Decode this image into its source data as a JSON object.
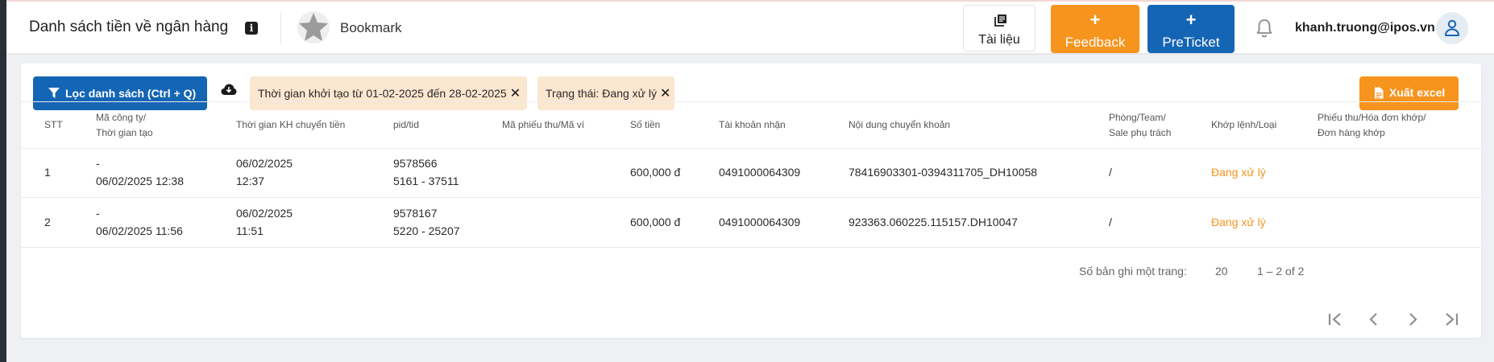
{
  "header": {
    "title": "Danh sách tiền về ngân hàng",
    "bookmark_label": "Bookmark",
    "docs_label": "Tài liệu",
    "feedback_label": "Feedback",
    "preticket_label": "PreTicket",
    "plus": "+",
    "user_email": "khanh.truong@ipos.vn"
  },
  "toolbar": {
    "filter_label": "Lọc danh sách (Ctrl + Q)",
    "chips": [
      {
        "text": "Thời gian khởi tạo từ 01-02-2025 đến 28-02-2025"
      },
      {
        "text": "Trạng thái: Đang xử lý"
      }
    ],
    "chip_remove": "✕",
    "export_label": "Xuất excel"
  },
  "table": {
    "columns": [
      {
        "line1": "STT",
        "line2": ""
      },
      {
        "line1": "Mã công ty/",
        "line2": "Thời gian tạo"
      },
      {
        "line1": "Thời gian KH chuyển tiền",
        "line2": ""
      },
      {
        "line1": "pid/tid",
        "line2": ""
      },
      {
        "line1": "Mã phiếu thu/Mã ví",
        "line2": ""
      },
      {
        "line1": "Số tiền",
        "line2": ""
      },
      {
        "line1": "Tài khoản nhận",
        "line2": ""
      },
      {
        "line1": "Nội dung chuyển khoản",
        "line2": ""
      },
      {
        "line1": "Phòng/Team/",
        "line2": "Sale phụ trách"
      },
      {
        "line1": "Khớp lệnh/Loại",
        "line2": ""
      },
      {
        "line1": "Phiếu thu/Hóa đơn khớp/",
        "line2": "Đơn hàng khớp"
      }
    ],
    "rows": [
      {
        "stt": "1",
        "company": "-",
        "created": "06/02/2025 12:38",
        "transfer_date": "06/02/2025",
        "transfer_time": "12:37",
        "pid": "9578566",
        "tid": "5161 - 37511",
        "receipt": "",
        "amount": "600,000 đ",
        "account": "0491000064309",
        "content": "78416903301-0394311705_DH10058",
        "team": "/",
        "status": "Đang xử lý",
        "matched": ""
      },
      {
        "stt": "2",
        "company": "-",
        "created": "06/02/2025 11:56",
        "transfer_date": "06/02/2025",
        "transfer_time": "11:51",
        "pid": "9578167",
        "tid": "5220 - 25207",
        "receipt": "",
        "amount": "600,000 đ",
        "account": "0491000064309",
        "content": "923363.060225.115157.DH10047",
        "team": "/",
        "status": "Đang xử lý",
        "matched": ""
      }
    ]
  },
  "pagination": {
    "per_page_label": "Số bản ghi một trang:",
    "per_page_value": "20",
    "range": "1 – 2 of 2"
  },
  "colors": {
    "primary": "#1565b5",
    "accent": "#f7941d",
    "chip_bg": "#fbe6d0"
  }
}
